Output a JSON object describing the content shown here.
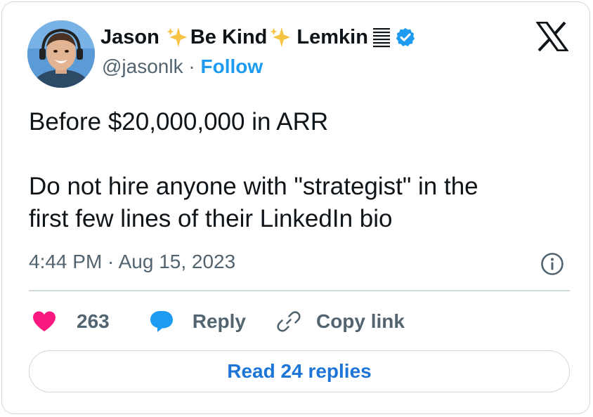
{
  "author": {
    "name_first": "Jason",
    "name_middle": "Be Kind",
    "name_last": "Lemkin",
    "handle": "@jasonlk",
    "separator": " · ",
    "follow_label": "Follow",
    "verified": true
  },
  "tweet": {
    "line1": "Before $20,000,000 in ARR",
    "line2": "Do not hire anyone with \"strategist\" in the",
    "line3": "first few lines of their LinkedIn bio",
    "timestamp": "4:44 PM · Aug 15, 2023"
  },
  "actions": {
    "like_count": "263",
    "reply_label": "Reply",
    "copy_label": "Copy link"
  },
  "footer": {
    "read_replies_label": "Read 24 replies"
  },
  "colors": {
    "link_blue": "#1d9bf0",
    "heart_pink": "#f91880",
    "text_dark": "#0f1419",
    "text_gray": "#536471",
    "border": "#cfd9de"
  },
  "icons": [
    "sparkle-icon",
    "list-icon",
    "verified-badge-icon",
    "x-logo-icon",
    "info-icon",
    "heart-icon",
    "reply-bubble-icon",
    "link-icon"
  ]
}
